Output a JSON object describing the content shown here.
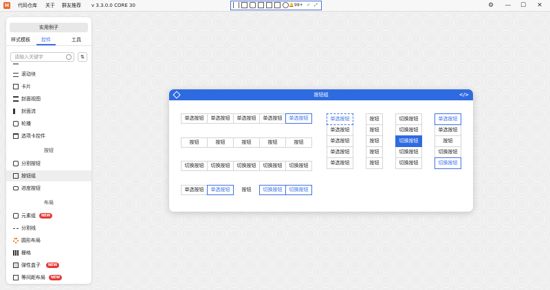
{
  "titlebar": {
    "logo": "H",
    "menu": [
      "代码仓库",
      "关于",
      "群友推荐"
    ],
    "version": "v 3.3.0.0 CORE 30",
    "badge": "99+"
  },
  "sidebar": {
    "examples_button": "实用例子",
    "tabs": [
      "样式模板",
      "控件",
      "工具"
    ],
    "active_tab": 1,
    "search_placeholder": "请输入关键字",
    "items_top": [
      {
        "label": "滚动块",
        "icon": "slider-icon"
      },
      {
        "label": "卡片",
        "icon": "card-icon"
      },
      {
        "label": "封面视图",
        "icon": "cover-view-icon"
      },
      {
        "label": "封面流",
        "icon": "cover-flow-icon"
      },
      {
        "label": "轮播",
        "icon": "carousel-icon"
      },
      {
        "label": "选项卡控件",
        "icon": "tab-control-icon"
      }
    ],
    "section_buttons": "按钮",
    "items_buttons": [
      {
        "label": "分割按钮",
        "icon": "split-button-icon"
      },
      {
        "label": "按钮组",
        "icon": "button-group-icon"
      },
      {
        "label": "进度按钮",
        "icon": "progress-button-icon"
      }
    ],
    "section_layout": "布局",
    "items_layout": [
      {
        "label": "元素组",
        "icon": "element-group-icon",
        "new": "NEW"
      },
      {
        "label": "分割线",
        "icon": "divider-icon"
      },
      {
        "label": "圆形布局",
        "icon": "circle-layout-icon"
      },
      {
        "label": "栅格",
        "icon": "grid-icon"
      },
      {
        "label": "弹性盒子",
        "icon": "flexbox-icon",
        "new": "NEW"
      },
      {
        "label": "等间距布局",
        "icon": "spacing-layout-icon",
        "new": "NEW"
      }
    ]
  },
  "card": {
    "title": "按钮组",
    "code_label": "</>",
    "row1": [
      "单选按钮",
      "单选按钮",
      "单选按钮",
      "单选按钮",
      "单选按钮"
    ],
    "row2": [
      "按钮",
      "按钮",
      "按钮",
      "按钮",
      "按钮"
    ],
    "row3": [
      "切换按钮",
      "切换按钮",
      "切换按钮",
      "切换按钮",
      "切换按钮"
    ],
    "row4": [
      "单选按钮",
      "单选按钮",
      "按钮",
      "切换按钮",
      "切换按钮"
    ],
    "col1": [
      "单选按钮",
      "单选按钮",
      "单选按钮",
      "单选按钮",
      "单选按钮"
    ],
    "col2": [
      "按钮",
      "按钮",
      "按钮",
      "按钮",
      "按钮"
    ],
    "col3": [
      "切换按钮",
      "切换按钮",
      "切换按钮",
      "切换按钮",
      "切换按钮"
    ],
    "col4": [
      "单选按钮",
      "单选按钮",
      "按钮",
      "切换按钮",
      "切换按钮"
    ]
  },
  "colors": {
    "accent": "#2f6be0",
    "new_badge": "#e53935",
    "logo": "#e86a2c"
  }
}
